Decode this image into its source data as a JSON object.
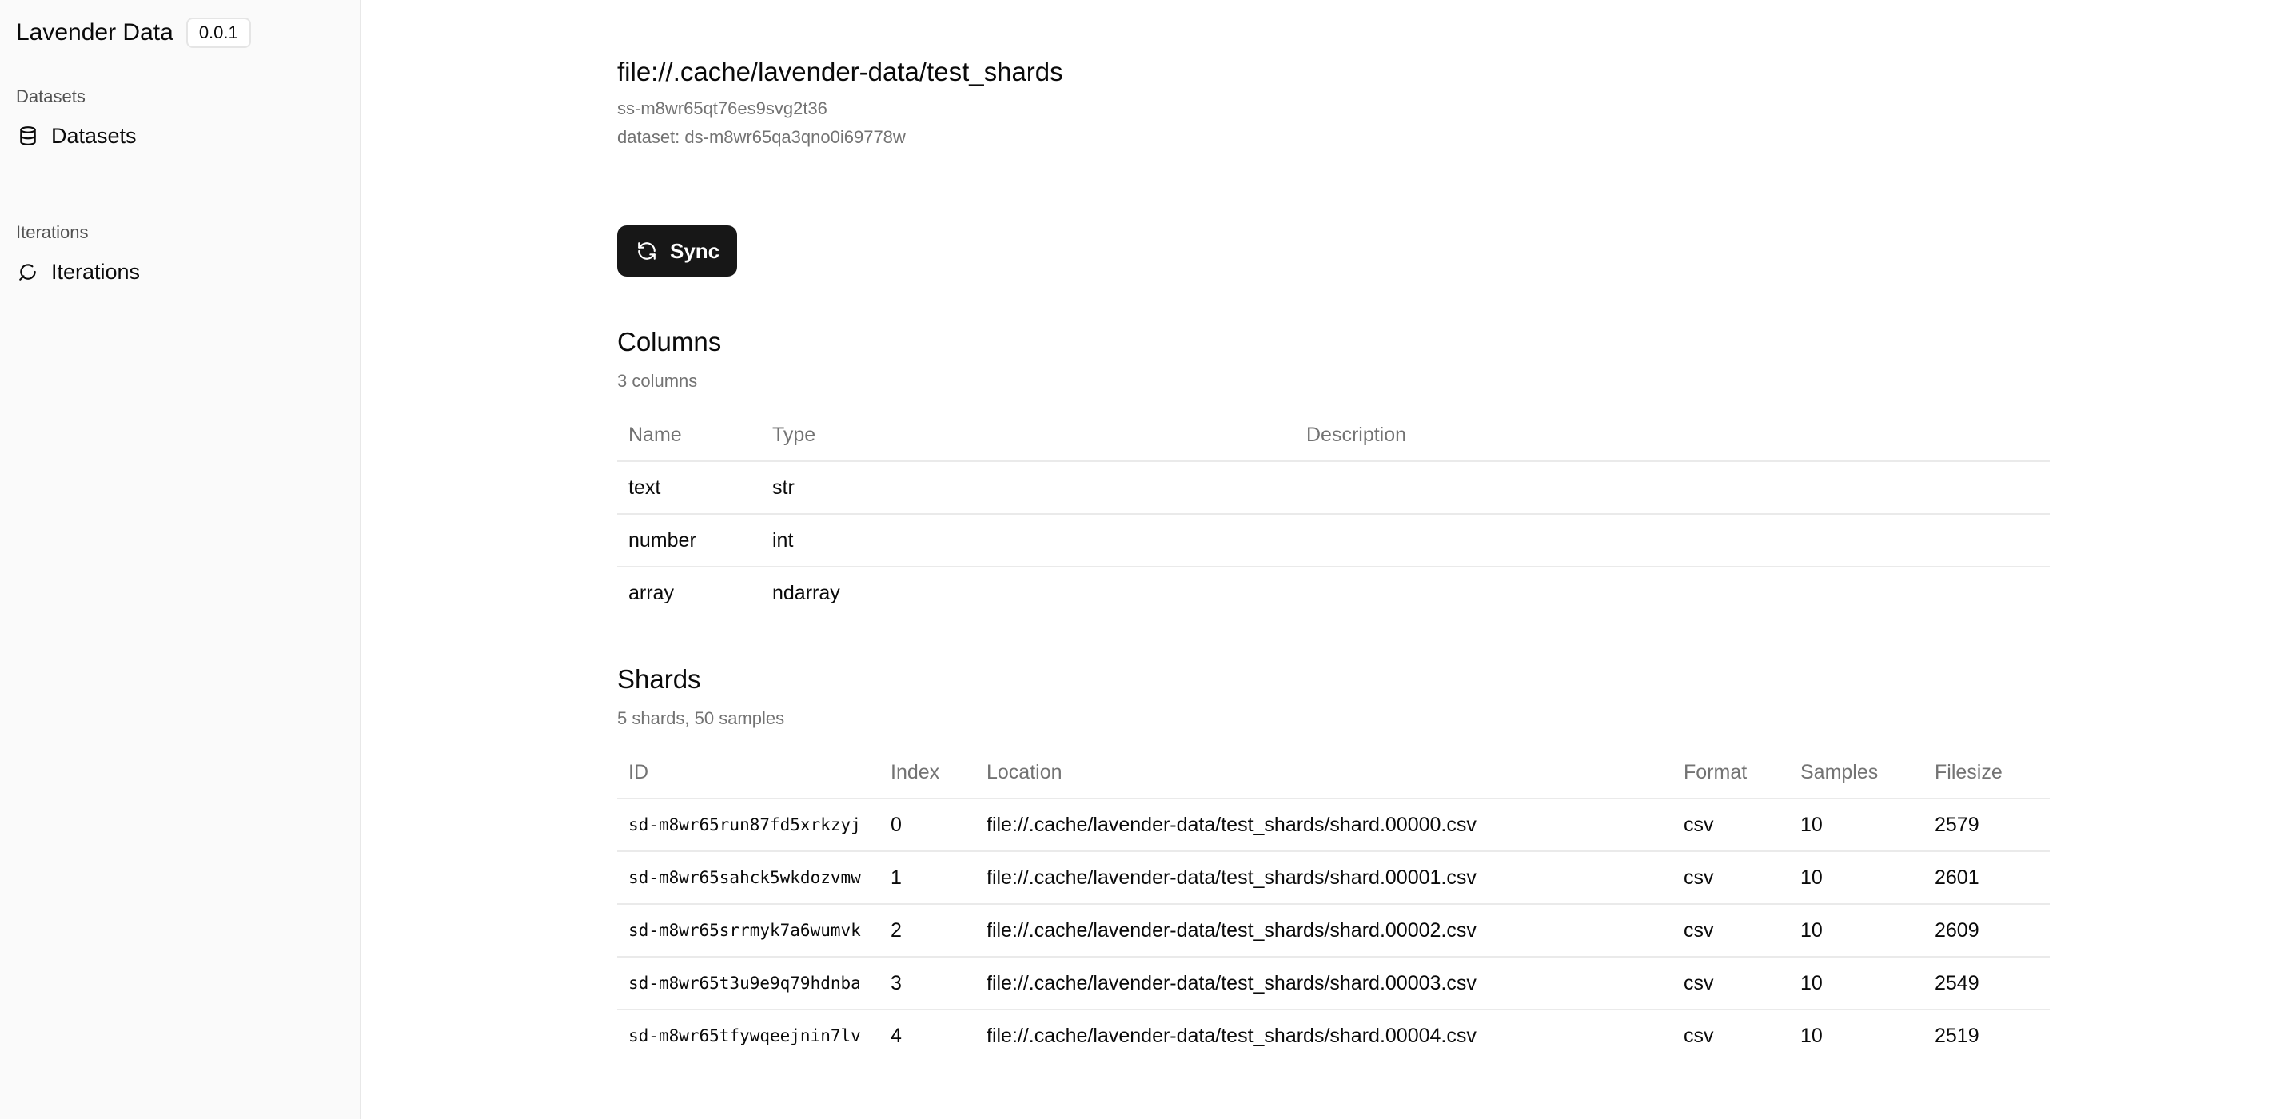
{
  "app": {
    "name": "Lavender Data",
    "version": "0.0.1"
  },
  "sidebar": {
    "groups": [
      {
        "label": "Datasets",
        "items": [
          {
            "label": "Datasets",
            "icon": "database-icon"
          }
        ]
      },
      {
        "label": "Iterations",
        "items": [
          {
            "label": "Iterations",
            "icon": "iterations-icon"
          }
        ]
      }
    ]
  },
  "page": {
    "title": "file://.cache/lavender-data/test_shards",
    "shardset_id": "ss-m8wr65qt76es9svg2t36",
    "dataset_line": "dataset: ds-m8wr65qa3qno0i69778w"
  },
  "actions": {
    "sync_label": "Sync"
  },
  "columns_section": {
    "title": "Columns",
    "summary": "3 columns",
    "headers": [
      "Name",
      "Type",
      "Description"
    ],
    "rows": [
      {
        "name": "text",
        "type": "str",
        "description": ""
      },
      {
        "name": "number",
        "type": "int",
        "description": ""
      },
      {
        "name": "array",
        "type": "ndarray",
        "description": ""
      }
    ]
  },
  "shards_section": {
    "title": "Shards",
    "summary": "5 shards, 50 samples",
    "headers": [
      "ID",
      "Index",
      "Location",
      "Format",
      "Samples",
      "Filesize"
    ],
    "rows": [
      {
        "id": "sd-m8wr65run87fd5xrkzyj",
        "index": "0",
        "location": "file://.cache/lavender-data/test_shards/shard.00000.csv",
        "format": "csv",
        "samples": "10",
        "filesize": "2579"
      },
      {
        "id": "sd-m8wr65sahck5wkdozvmw",
        "index": "1",
        "location": "file://.cache/lavender-data/test_shards/shard.00001.csv",
        "format": "csv",
        "samples": "10",
        "filesize": "2601"
      },
      {
        "id": "sd-m8wr65srrmyk7a6wumvk",
        "index": "2",
        "location": "file://.cache/lavender-data/test_shards/shard.00002.csv",
        "format": "csv",
        "samples": "10",
        "filesize": "2609"
      },
      {
        "id": "sd-m8wr65t3u9e9q79hdnba",
        "index": "3",
        "location": "file://.cache/lavender-data/test_shards/shard.00003.csv",
        "format": "csv",
        "samples": "10",
        "filesize": "2549"
      },
      {
        "id": "sd-m8wr65tfywqeejnin7lv",
        "index": "4",
        "location": "file://.cache/lavender-data/test_shards/shard.00004.csv",
        "format": "csv",
        "samples": "10",
        "filesize": "2519"
      }
    ]
  }
}
